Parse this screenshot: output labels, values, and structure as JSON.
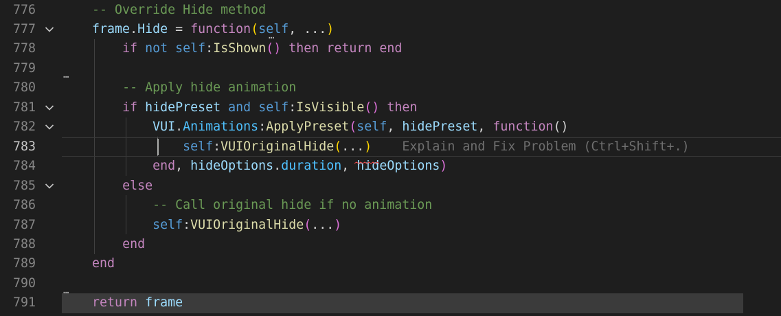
{
  "editor": {
    "lines": [
      {
        "num": "776",
        "fold": false,
        "tokens": [
          {
            "t": "    ",
            "c": "pn"
          },
          {
            "t": "-- Override Hide method",
            "c": "cm"
          }
        ]
      },
      {
        "num": "777",
        "fold": true,
        "tokens": [
          {
            "t": "    ",
            "c": "pn"
          },
          {
            "t": "frame",
            "c": "var"
          },
          {
            "t": ".",
            "c": "pn"
          },
          {
            "t": "Hide",
            "c": "var"
          },
          {
            "t": " = ",
            "c": "pn"
          },
          {
            "t": "function",
            "c": "kw"
          },
          {
            "t": "(",
            "c": "br1"
          },
          {
            "t": "self",
            "c": "sf"
          },
          {
            "t": ", ",
            "c": "pn"
          },
          {
            "t": "...",
            "c": "pn"
          },
          {
            "t": ")",
            "c": "br1"
          }
        ]
      },
      {
        "num": "778",
        "fold": false,
        "tokens": [
          {
            "t": "        ",
            "c": "pn"
          },
          {
            "t": "if",
            "c": "kw"
          },
          {
            "t": " ",
            "c": "pn"
          },
          {
            "t": "not",
            "c": "kwb"
          },
          {
            "t": " ",
            "c": "pn"
          },
          {
            "t": "self",
            "c": "sf"
          },
          {
            "t": ":",
            "c": "pn"
          },
          {
            "t": "IsShown",
            "c": "fn"
          },
          {
            "t": "()",
            "c": "br2"
          },
          {
            "t": " ",
            "c": "pn"
          },
          {
            "t": "then",
            "c": "kw"
          },
          {
            "t": " ",
            "c": "pn"
          },
          {
            "t": "return",
            "c": "kw"
          },
          {
            "t": " ",
            "c": "pn"
          },
          {
            "t": "end",
            "c": "kw"
          }
        ]
      },
      {
        "num": "779",
        "fold": false,
        "tokens": []
      },
      {
        "num": "780",
        "fold": false,
        "tokens": [
          {
            "t": "        ",
            "c": "pn"
          },
          {
            "t": "-- Apply hide animation",
            "c": "cm"
          }
        ]
      },
      {
        "num": "781",
        "fold": true,
        "tokens": [
          {
            "t": "        ",
            "c": "pn"
          },
          {
            "t": "if",
            "c": "kw"
          },
          {
            "t": " ",
            "c": "pn"
          },
          {
            "t": "hidePreset",
            "c": "var"
          },
          {
            "t": " ",
            "c": "pn"
          },
          {
            "t": "and",
            "c": "kwb"
          },
          {
            "t": " ",
            "c": "pn"
          },
          {
            "t": "self",
            "c": "sf"
          },
          {
            "t": ":",
            "c": "pn"
          },
          {
            "t": "IsVisible",
            "c": "fn"
          },
          {
            "t": "()",
            "c": "br2"
          },
          {
            "t": " ",
            "c": "pn"
          },
          {
            "t": "then",
            "c": "kw"
          }
        ]
      },
      {
        "num": "782",
        "fold": true,
        "tokens": [
          {
            "t": "            ",
            "c": "pn"
          },
          {
            "t": "VUI",
            "c": "var"
          },
          {
            "t": ".",
            "c": "pn"
          },
          {
            "t": "Animations",
            "c": "ob"
          },
          {
            "t": ":",
            "c": "pn"
          },
          {
            "t": "ApplyPreset",
            "c": "fn"
          },
          {
            "t": "(",
            "c": "br2"
          },
          {
            "t": "self",
            "c": "sf"
          },
          {
            "t": ", ",
            "c": "pn"
          },
          {
            "t": "hidePreset",
            "c": "var"
          },
          {
            "t": ", ",
            "c": "pn"
          },
          {
            "t": "function",
            "c": "kw"
          },
          {
            "t": "()",
            "c": "pn"
          }
        ]
      },
      {
        "num": "783",
        "fold": false,
        "current": true,
        "tokens": [
          {
            "t": "                ",
            "c": "pn"
          },
          {
            "t": "self",
            "c": "sf"
          },
          {
            "t": ":",
            "c": "pn"
          },
          {
            "t": "VUIOriginalHide",
            "c": "fn"
          },
          {
            "t": "(",
            "c": "br1"
          },
          {
            "t": "...",
            "c": "pn"
          },
          {
            "t": ")",
            "c": "br1"
          },
          {
            "t": "    ",
            "c": "pn"
          },
          {
            "t": "Explain and Fix Problem (Ctrl+Shift+.)",
            "c": "ghost"
          }
        ]
      },
      {
        "num": "784",
        "fold": false,
        "tokens": [
          {
            "t": "            ",
            "c": "pn"
          },
          {
            "t": "end",
            "c": "kw"
          },
          {
            "t": ", ",
            "c": "pn"
          },
          {
            "t": "hideOptions",
            "c": "var"
          },
          {
            "t": ".",
            "c": "pn"
          },
          {
            "t": "duration",
            "c": "ob"
          },
          {
            "t": ", ",
            "c": "pn"
          },
          {
            "t": "hideOptions",
            "c": "var"
          },
          {
            "t": ")",
            "c": "br2"
          }
        ]
      },
      {
        "num": "785",
        "fold": true,
        "tokens": [
          {
            "t": "        ",
            "c": "pn"
          },
          {
            "t": "else",
            "c": "kw"
          }
        ]
      },
      {
        "num": "786",
        "fold": false,
        "tokens": [
          {
            "t": "            ",
            "c": "pn"
          },
          {
            "t": "-- Call original hide if no animation",
            "c": "cm"
          }
        ]
      },
      {
        "num": "787",
        "fold": false,
        "tokens": [
          {
            "t": "            ",
            "c": "pn"
          },
          {
            "t": "self",
            "c": "sf"
          },
          {
            "t": ":",
            "c": "pn"
          },
          {
            "t": "VUIOriginalHide",
            "c": "fn"
          },
          {
            "t": "(",
            "c": "br2"
          },
          {
            "t": "...",
            "c": "pn"
          },
          {
            "t": ")",
            "c": "br2"
          }
        ]
      },
      {
        "num": "788",
        "fold": false,
        "tokens": [
          {
            "t": "        ",
            "c": "pn"
          },
          {
            "t": "end",
            "c": "kw"
          }
        ]
      },
      {
        "num": "789",
        "fold": false,
        "tokens": [
          {
            "t": "    ",
            "c": "pn"
          },
          {
            "t": "end",
            "c": "kw"
          }
        ]
      },
      {
        "num": "790",
        "fold": false,
        "tokens": []
      },
      {
        "num": "791",
        "fold": false,
        "last": true,
        "tokens": [
          {
            "t": "    ",
            "c": "pn"
          },
          {
            "t": "return",
            "c": "kw"
          },
          {
            "t": " ",
            "c": "pn"
          },
          {
            "t": "frame",
            "c": "var"
          }
        ]
      }
    ],
    "fold_icon": "chevron-down-icon",
    "inline_hint_icon": "ellipsis-icon",
    "colors": {
      "background": "#1e1e1e",
      "keyword": "#c586c0",
      "comment": "#6a9955",
      "variable": "#9cdcfe",
      "function": "#dcdcaa",
      "self": "#569cd6"
    }
  }
}
